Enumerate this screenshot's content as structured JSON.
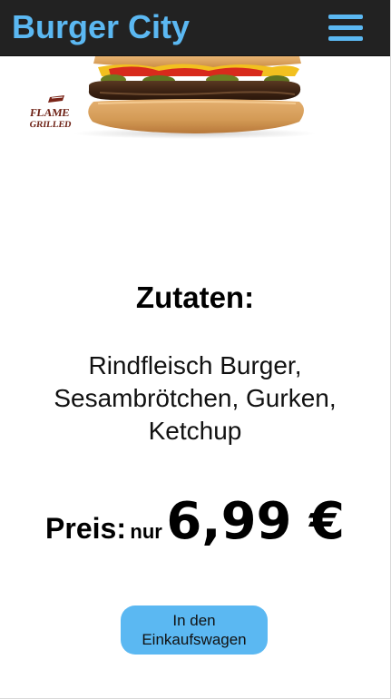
{
  "header": {
    "brand": "Burger City",
    "menu_icon": "hamburger-menu-icon"
  },
  "product": {
    "image_icon": "burger-photo",
    "badge_text": "FLAME GRILLED"
  },
  "ingredients": {
    "title": "Zutaten:",
    "text": "Rindfleisch Burger, Sesambrötchen, Gurken, Ketchup"
  },
  "price": {
    "label": "Preis:",
    "prefix": "nur",
    "value": "6,99 €"
  },
  "cart_button": {
    "label": "In den Einkaufswagen"
  },
  "colors": {
    "accent": "#5bb8f2",
    "header_bg": "#222222"
  }
}
